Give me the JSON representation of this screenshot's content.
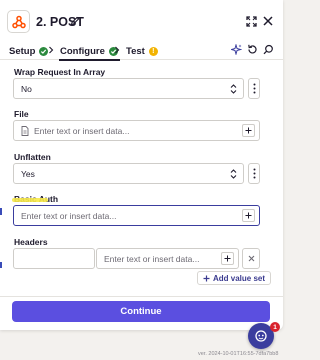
{
  "header": {
    "step_title": "2. POST",
    "icons": [
      "webhook-icon",
      "pencil-icon",
      "expand-icon",
      "close-icon"
    ]
  },
  "tabs": [
    {
      "label": "Setup",
      "status": "complete"
    },
    {
      "label": "Configure",
      "status": "complete",
      "active": true
    },
    {
      "label": "Test",
      "status": "warning",
      "badge": "!"
    }
  ],
  "toolbar_icons": [
    "sparkle-icon",
    "refresh-icon",
    "search-icon"
  ],
  "fields": {
    "wrap_request": {
      "label": "Wrap Request In Array",
      "value": "No"
    },
    "file": {
      "label": "File",
      "placeholder": "Enter text or insert data..."
    },
    "unflatten": {
      "label": "Unflatten",
      "value": "Yes"
    },
    "basic_auth": {
      "label": "Basic Auth",
      "placeholder": "Enter text or insert data..."
    },
    "headers": {
      "label": "Headers",
      "value_placeholder": "Enter text or insert data...",
      "add_label": "Add value set"
    }
  },
  "footer": {
    "continue_label": "Continue"
  },
  "chat": {
    "badge": "1"
  },
  "version": "ver. 2024-10-01T16:55-7dfa7bb8",
  "colors": {
    "primary": "#5b4fe0",
    "focus": "#3a3d9e",
    "success": "#2b8a3e",
    "warning": "#f2b301",
    "brand": "#ff4f00",
    "highlight": "#f7e94a"
  }
}
